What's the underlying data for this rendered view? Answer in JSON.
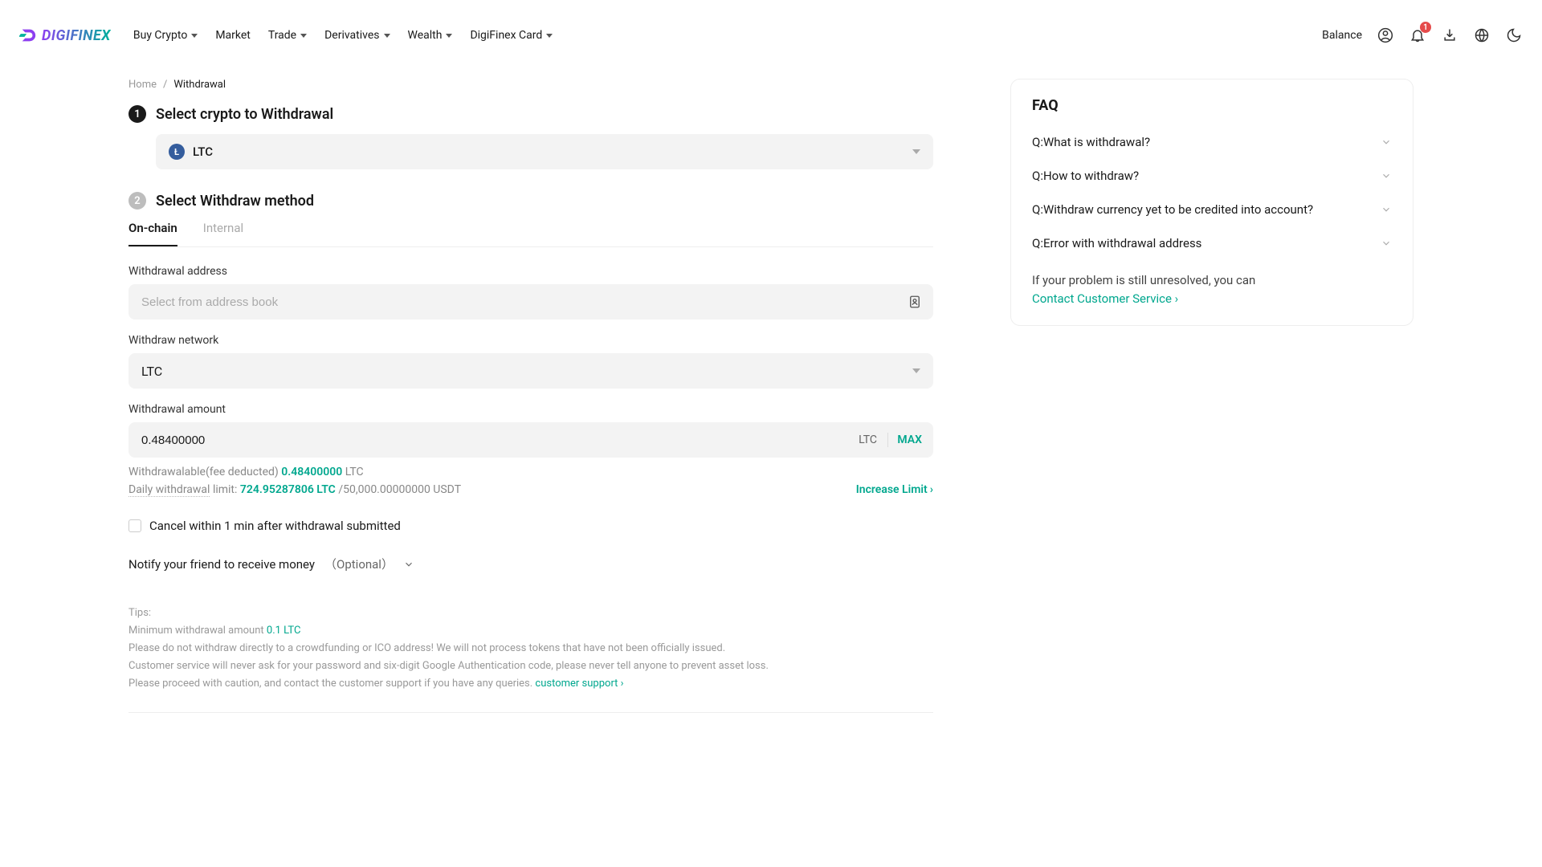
{
  "brand": {
    "name": "DIGIFINEX"
  },
  "nav": {
    "buy_crypto": "Buy Crypto",
    "market": "Market",
    "trade": "Trade",
    "derivatives": "Derivatives",
    "wealth": "Wealth",
    "card": "DigiFinex Card"
  },
  "header_right": {
    "balance": "Balance",
    "notification_count": "1"
  },
  "breadcrumb": {
    "home": "Home",
    "sep": "/",
    "current": "Withdrawal"
  },
  "step1": {
    "num": "1",
    "title": "Select crypto to Withdrawal",
    "coin_symbol": "LTC",
    "coin_glyph": "Ł"
  },
  "step2": {
    "num": "2",
    "title": "Select Withdraw method",
    "tab_onchain": "On-chain",
    "tab_internal": "Internal"
  },
  "fields": {
    "address_label": "Withdrawal address",
    "address_placeholder": "Select from address book",
    "network_label": "Withdraw network",
    "network_value": "LTC",
    "amount_label": "Withdrawal amount",
    "amount_value": "0.48400000",
    "amount_unit": "LTC",
    "max": "MAX"
  },
  "withdrawable": {
    "label": "Withdrawalable(fee deducted) ",
    "value": "0.48400000",
    "unit": " LTC"
  },
  "daily": {
    "label": "Daily withdrawal",
    "limit_word": " limit: ",
    "used": "724.95287806 LTC",
    "total": "/50,000.00000000 USDT",
    "increase": "Increase Limit ",
    "increase_arrow": "›"
  },
  "cancel_row": "Cancel within 1 min after withdrawal submitted",
  "notify_row": {
    "main": "Notify your friend to receive money",
    "optional": "（Optional）"
  },
  "tips": {
    "head": "Tips:",
    "min_label": "Minimum withdrawal amount ",
    "min_value": "0.1 LTC",
    "line1": "Please do not withdraw directly to a crowdfunding or ICO address! We will not process tokens that have not been officially issued.",
    "line2": "Customer service will never ask for your password and six-digit Google Authentication code, please never tell anyone to prevent asset loss.",
    "line3_a": "Please proceed with caution, and contact the customer support if you have any queries. ",
    "line3_link": "customer support  ›"
  },
  "faq": {
    "title": "FAQ",
    "q1": "Q:What is withdrawal?",
    "q2": "Q:How to withdraw?",
    "q3": "Q:Withdraw currency yet to be credited into account?",
    "q4": "Q:Error with withdrawal address",
    "footer_text": "If your problem is still unresolved, you can",
    "footer_link": "Contact Customer Service ›"
  }
}
